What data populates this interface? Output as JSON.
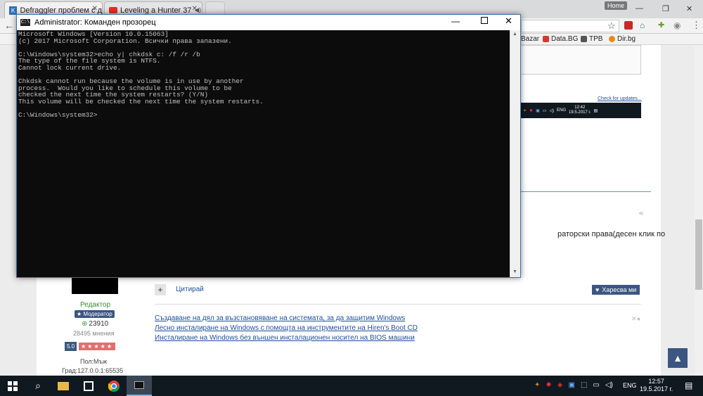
{
  "browser": {
    "tabs": [
      {
        "title": "Defraggler проблем с д"
      },
      {
        "title": "Leveling a Hunter 37"
      }
    ],
    "home_badge": "Home",
    "bookmarks": [
      {
        "label": "Bazar",
        "color": "#e8a23a"
      },
      {
        "label": "Data.BG",
        "color": "#d33a2c"
      },
      {
        "label": "TPB",
        "color": "#555555"
      },
      {
        "label": "Dir.bg",
        "color": "#e58b1c"
      }
    ]
  },
  "cmd": {
    "title": "Administrator: Команден прозорец",
    "lines": [
      "Microsoft Windows [Version 10.0.15063]",
      "(c) 2017 Microsoft Corporation. Всички права запазени.",
      "",
      "C:\\Windows\\system32>echo y| chkdsk c: /f /r /b",
      "The type of the file system is NTFS.",
      "Cannot lock current drive.",
      "",
      "Chkdsk cannot run because the volume is in use by another",
      "process.  Would you like to schedule this volume to be",
      "checked the next time the system restarts? (Y/N)",
      "This volume will be checked the next time the system restarts.",
      "",
      "C:\\Windows\\system32>"
    ]
  },
  "forum": {
    "check_updates": "Check for updates...",
    "inner_clock": {
      "time": "12:42",
      "date": "19.5.2017 г."
    },
    "inner_lang": "ENG",
    "side_text": "раторски права(десен клик по",
    "quote_label": "Цитирай",
    "like_label": "Харесва ми",
    "user": {
      "role": "Редактор",
      "badge": "★ Модератор",
      "points": "23910",
      "posts": "28495 мнения",
      "rating": "5.0",
      "stars": "★★★★★",
      "gender": "Пол:Мъж",
      "city": "Град:127.0.0.1:65535"
    },
    "related_links": [
      "Създаване на дял за възстановяване на системата, за да защитим Windows",
      "Лесно инсталиране на Windows с помощта на инструментите на Hiren's Boot CD",
      "Инсталиране на Windows без външен инсталационен носител на BIOS машини"
    ]
  },
  "taskbar": {
    "lang": "ENG",
    "time": "12:57",
    "date": "19.5.2017 г."
  }
}
